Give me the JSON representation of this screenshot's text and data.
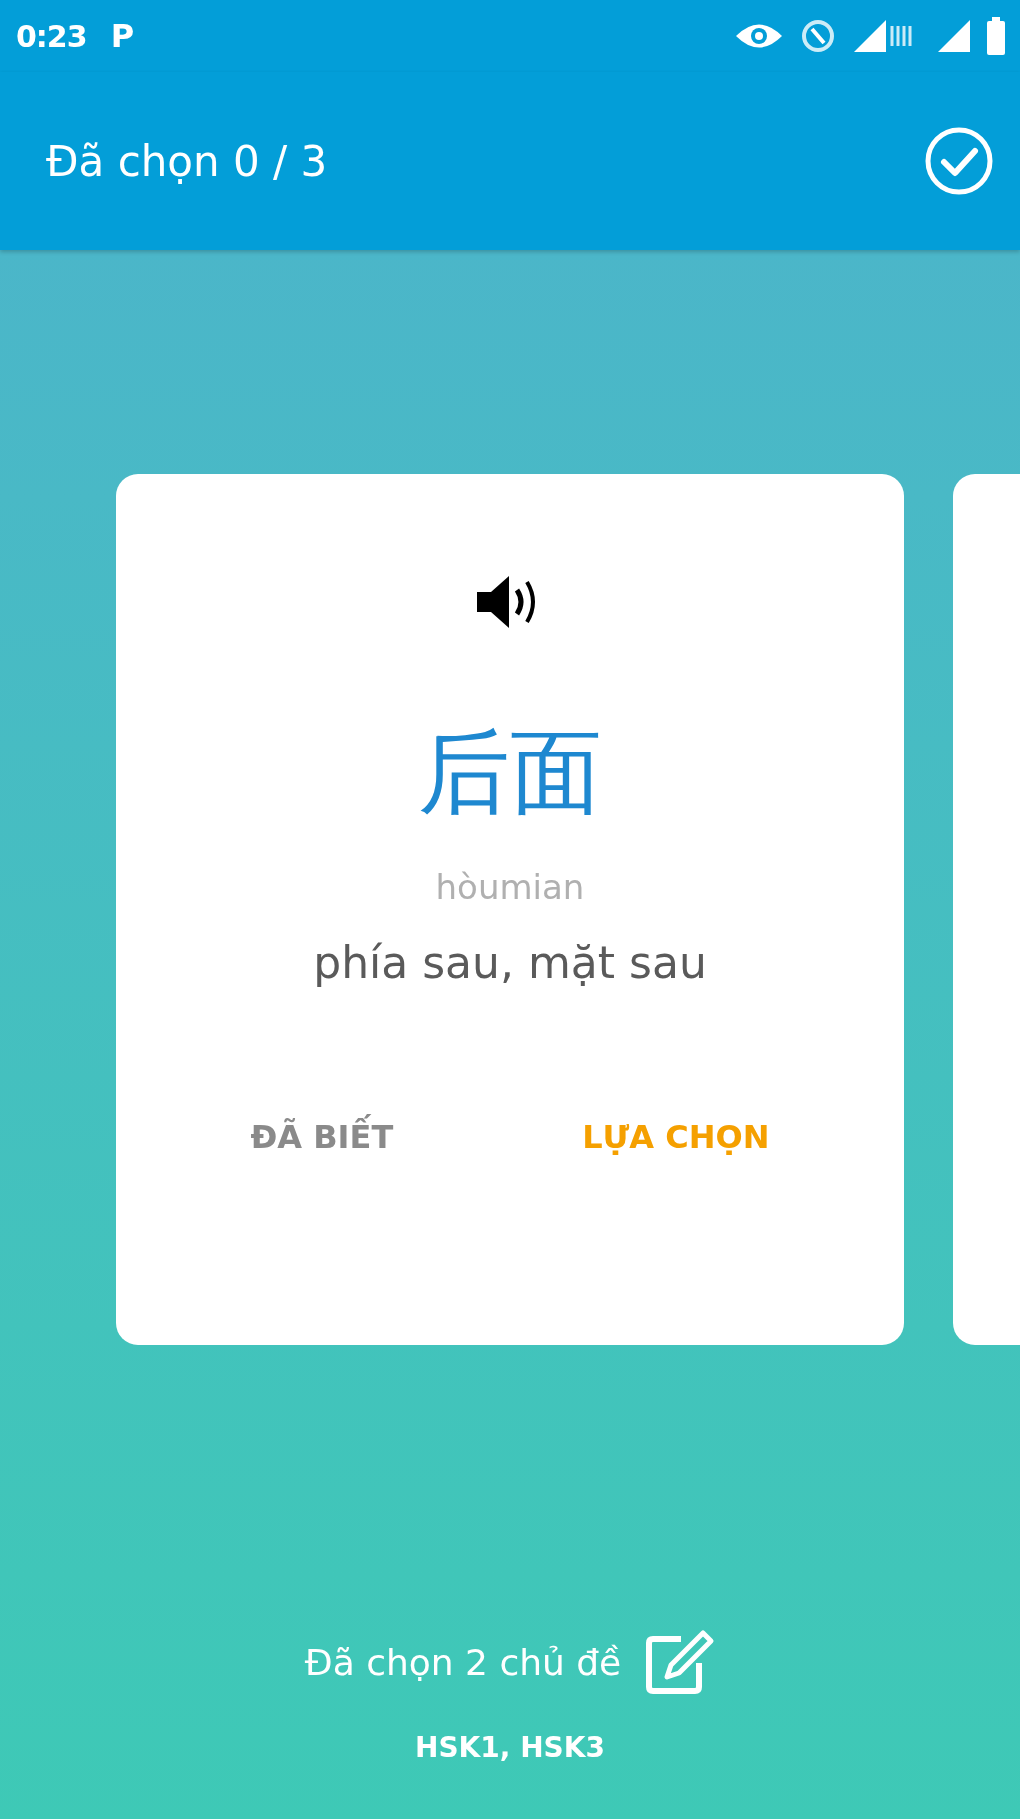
{
  "status_bar": {
    "time": "0:23",
    "notification": "P"
  },
  "header": {
    "title": "Đã chọn 0 / 3"
  },
  "card": {
    "word": "后面",
    "pinyin": "hòumian",
    "meaning": "phía sau, mặt sau",
    "actions": [
      {
        "label": "ĐÃ BIẾT",
        "kind": "known"
      },
      {
        "label": "LỰA CHỌN",
        "kind": "select"
      }
    ]
  },
  "topics": {
    "summary": "Đã chọn 2 chủ đề",
    "list": "HSK1, HSK3"
  }
}
